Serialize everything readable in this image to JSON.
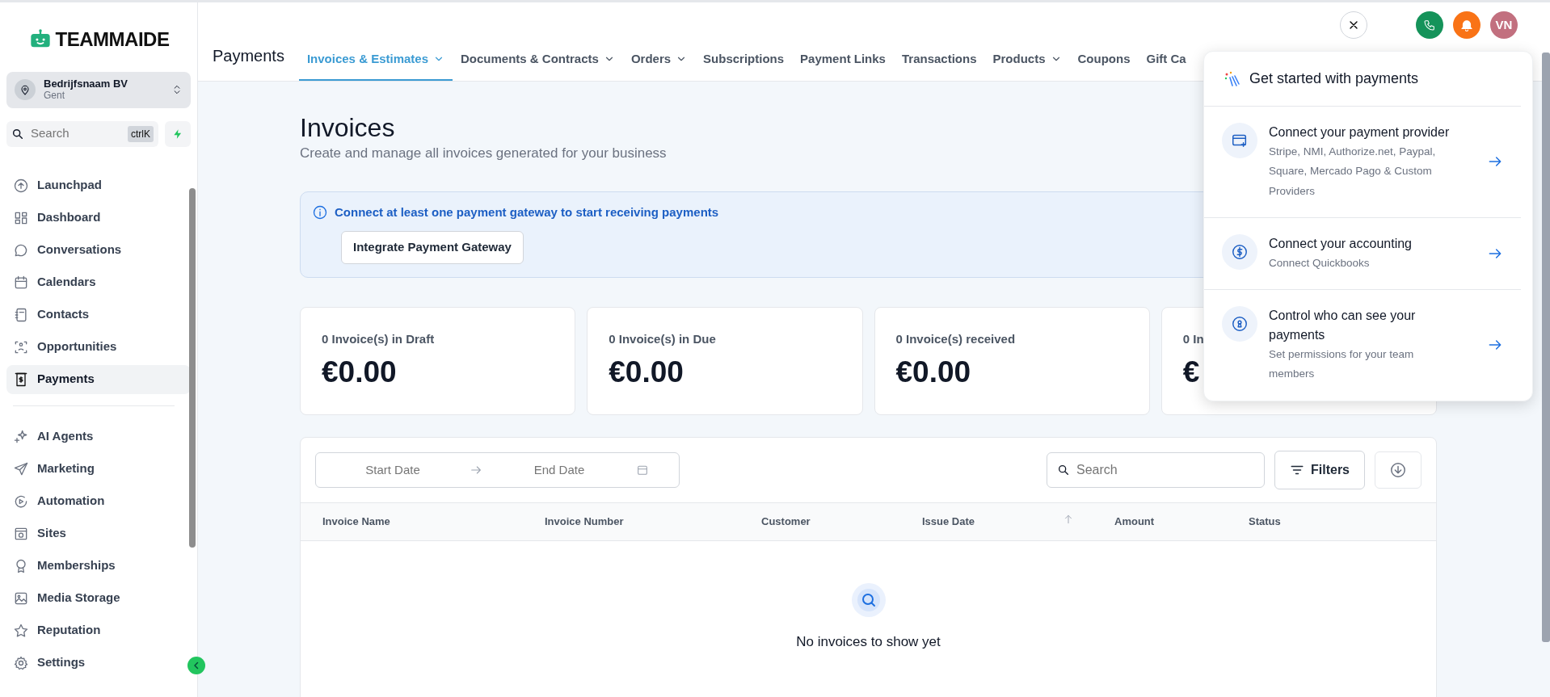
{
  "sidebar": {
    "logo": "TEAMMAIDE",
    "company": {
      "name": "Bedrijfsnaam BV",
      "location": "Gent"
    },
    "search": {
      "placeholder": "Search",
      "shortcut": "ctrlK"
    },
    "groups": [
      {
        "items": [
          {
            "label": "Launchpad",
            "selected": false
          },
          {
            "label": "Dashboard",
            "selected": false
          },
          {
            "label": "Conversations",
            "selected": false
          },
          {
            "label": "Calendars",
            "selected": false
          },
          {
            "label": "Contacts",
            "selected": false
          },
          {
            "label": "Opportunities",
            "selected": false
          },
          {
            "label": "Payments",
            "selected": true
          }
        ]
      },
      {
        "items": [
          {
            "label": "AI Agents",
            "selected": false
          },
          {
            "label": "Marketing",
            "selected": false
          },
          {
            "label": "Automation",
            "selected": false
          },
          {
            "label": "Sites",
            "selected": false
          },
          {
            "label": "Memberships",
            "selected": false
          },
          {
            "label": "Media Storage",
            "selected": false
          },
          {
            "label": "Reputation",
            "selected": false
          },
          {
            "label": "Settings",
            "selected": false
          }
        ]
      }
    ]
  },
  "header": {
    "title": "Payments",
    "tabs": [
      {
        "label": "Invoices & Estimates",
        "dropdown": true,
        "selected": true
      },
      {
        "label": "Documents & Contracts",
        "dropdown": true,
        "selected": false
      },
      {
        "label": "Orders",
        "dropdown": true,
        "selected": false
      },
      {
        "label": "Subscriptions",
        "dropdown": false,
        "selected": false
      },
      {
        "label": "Payment Links",
        "dropdown": false,
        "selected": false
      },
      {
        "label": "Transactions",
        "dropdown": false,
        "selected": false
      },
      {
        "label": "Products",
        "dropdown": true,
        "selected": false
      },
      {
        "label": "Coupons",
        "dropdown": false,
        "selected": false
      },
      {
        "label": "Gift Ca",
        "dropdown": false,
        "selected": false
      }
    ],
    "avatar": "VN"
  },
  "page": {
    "title": "Invoices",
    "subtitle": "Create and manage all invoices generated for your business",
    "alert": {
      "message": "Connect at least one payment gateway to start receiving payments",
      "button": "Integrate Payment Gateway"
    },
    "stats": [
      {
        "label": "0 Invoice(s) in Draft",
        "amount": "€0.00"
      },
      {
        "label": "0 Invoice(s) in Due",
        "amount": "€0.00"
      },
      {
        "label": "0 Invoice(s) received",
        "amount": "€0.00"
      },
      {
        "label": "0 In",
        "amount": "€"
      }
    ],
    "table": {
      "start_placeholder": "Start Date",
      "end_placeholder": "End Date",
      "search_placeholder": "Search",
      "filters": "Filters",
      "columns": [
        {
          "label": "Invoice Name",
          "sorted": false
        },
        {
          "label": "Invoice Number",
          "sorted": false
        },
        {
          "label": "Customer",
          "sorted": false
        },
        {
          "label": "Issue Date",
          "sorted": true
        },
        {
          "label": "Amount",
          "sorted": false
        },
        {
          "label": "Status",
          "sorted": false
        }
      ],
      "empty": "No invoices to show yet"
    }
  },
  "popup": {
    "title": "Get started with payments",
    "items": [
      {
        "title": "Connect your payment provider",
        "description": "Stripe, NMI, Authorize.net, Paypal, Square, Mercado Pago & Custom Providers"
      },
      {
        "title": "Connect your accounting",
        "description": "Connect Quickbooks"
      },
      {
        "title": "Control who can see your payments",
        "description": "Set permissions for your team members"
      }
    ]
  }
}
